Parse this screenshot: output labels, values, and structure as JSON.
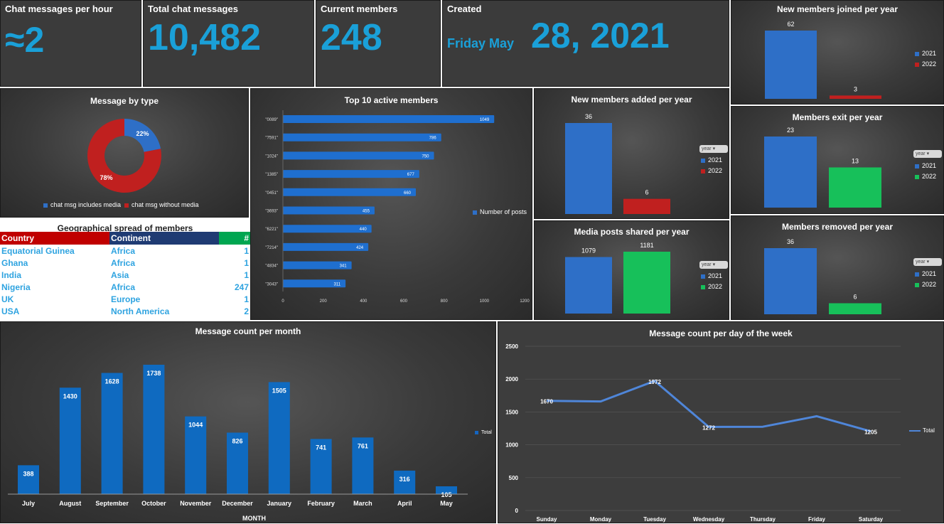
{
  "kpis": {
    "per_hour": {
      "title": "Chat messages per hour",
      "value": "≈2"
    },
    "total": {
      "title": "Total chat messages",
      "value": "10,482"
    },
    "members": {
      "title": "Current members",
      "value": "248"
    },
    "created": {
      "title": "Created",
      "weekday": "Friday May",
      "date": "28, 2021"
    }
  },
  "colors": {
    "blue": "#2e6fc7",
    "red": "#c0201f",
    "green": "#17c05a",
    "accent": "#1aa0d8"
  },
  "geo": {
    "title": "Geographical spread of members",
    "headers": [
      "Country",
      "Continent",
      "#"
    ],
    "rows": [
      [
        "Equatorial Guinea",
        "Africa",
        "1"
      ],
      [
        "Ghana",
        "Africa",
        "1"
      ],
      [
        "India",
        "Asia",
        "1"
      ],
      [
        "Nigeria",
        "Africa",
        "247"
      ],
      [
        "UK",
        "Europe",
        "1"
      ],
      [
        "USA",
        "North America",
        "2"
      ]
    ]
  },
  "slicer_label": "year",
  "chart_data": [
    {
      "id": "joined",
      "type": "bar",
      "title": "New members joined per year",
      "categories": [
        "2021",
        "2022"
      ],
      "values": [
        62,
        3
      ],
      "colors": [
        "#2e6fc7",
        "#c0201f"
      ],
      "ylim": [
        0,
        62
      ]
    },
    {
      "id": "pie",
      "type": "pie",
      "title": "Message by type",
      "labels": [
        "chat msg includes media",
        "chat msg without media"
      ],
      "values": [
        22,
        78
      ],
      "display": [
        "22%",
        "78%"
      ]
    },
    {
      "id": "top10",
      "type": "bar",
      "title": "Top 10 active members",
      "categories": [
        "\"0089\"",
        "\"7591\"",
        "\"1024\"",
        "\"1385\"",
        "\"0451\"",
        "\"3693\"",
        "\"6221\"",
        "\"7214\"",
        "\"4834\"",
        "\"3043\""
      ],
      "values": [
        1049,
        786,
        750,
        677,
        660,
        455,
        440,
        424,
        341,
        311
      ],
      "series_name": "Number of posts",
      "xticks": [
        0,
        200,
        400,
        600,
        800,
        1000,
        1200
      ],
      "xlim": [
        0,
        1200
      ]
    },
    {
      "id": "added",
      "type": "bar",
      "title": "New members added per year",
      "categories": [
        "2021",
        "2022"
      ],
      "values": [
        36,
        6
      ],
      "colors": [
        "#2e6fc7",
        "#c0201f"
      ],
      "ylim": [
        0,
        36
      ]
    },
    {
      "id": "exit",
      "type": "bar",
      "title": "Members exit per year",
      "categories": [
        "2021",
        "2022"
      ],
      "values": [
        23,
        13
      ],
      "colors": [
        "#2e6fc7",
        "#17c05a"
      ],
      "ylim": [
        0,
        23
      ]
    },
    {
      "id": "media",
      "type": "bar",
      "title": "Media posts shared per year",
      "categories": [
        "2021",
        "2022"
      ],
      "values": [
        1079,
        1181
      ],
      "colors": [
        "#2e6fc7",
        "#17c05a"
      ],
      "ylim": [
        0,
        1181
      ]
    },
    {
      "id": "removed",
      "type": "bar",
      "title": "Members removed per year",
      "categories": [
        "2021",
        "2022"
      ],
      "values": [
        36,
        6
      ],
      "colors": [
        "#2e6fc7",
        "#17c05a"
      ],
      "ylim": [
        0,
        36
      ]
    },
    {
      "id": "month",
      "type": "bar",
      "title": "Message count per month",
      "xlabel": "MONTH",
      "categories": [
        "July",
        "August",
        "September",
        "October",
        "November",
        "December",
        "January",
        "February",
        "March",
        "April",
        "May"
      ],
      "values": [
        388,
        1430,
        1628,
        1738,
        1044,
        826,
        1505,
        741,
        761,
        316,
        105
      ],
      "series_name": "Total",
      "ylim": [
        0,
        1738
      ]
    },
    {
      "id": "week",
      "type": "line",
      "title": "Message count per day of the week",
      "categories": [
        "Sunday",
        "Monday",
        "Tuesday",
        "Wednesday",
        "Thursday",
        "Friday",
        "Saturday"
      ],
      "values": [
        1670,
        1660,
        1972,
        1272,
        1275,
        1435,
        1205
      ],
      "labels": [
        "1670",
        "",
        "1972",
        "1272",
        "",
        "",
        "1205"
      ],
      "series_name": "Total",
      "yticks": [
        0,
        500,
        1000,
        1500,
        2000,
        2500
      ],
      "ylim": [
        0,
        2500
      ]
    }
  ]
}
